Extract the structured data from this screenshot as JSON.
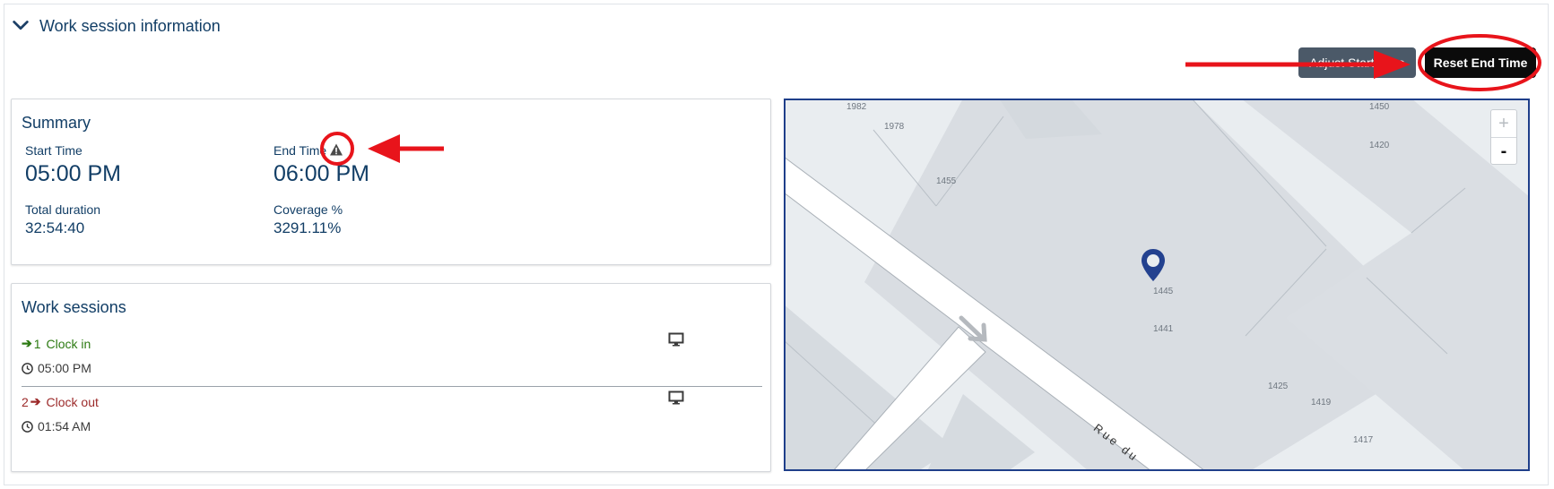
{
  "header": {
    "title": "Work session information",
    "icon": "chevron-down-icon"
  },
  "buttons": {
    "adjust_start": "Adjust Start Time",
    "reset_end": "Reset End Time"
  },
  "summary": {
    "title": "Summary",
    "start_label": "Start Time",
    "start_value": "05:00 PM",
    "end_label": "End Time",
    "end_value": "06:00 PM",
    "duration_label": "Total duration",
    "duration_value": "32:54:40",
    "coverage_label": "Coverage %",
    "coverage_value": "3291.11%",
    "warning_icon": "warning-icon"
  },
  "sessions": {
    "title": "Work sessions",
    "items": [
      {
        "prefix": "1",
        "label": "Clock in",
        "time": "05:00 PM"
      },
      {
        "prefix": "2",
        "label": "Clock out",
        "time": "01:54 AM"
      }
    ]
  },
  "map": {
    "zoom_in": "+",
    "zoom_out": "-",
    "labels": {
      "n1982": "1982",
      "n1978": "1978",
      "n1455": "1455",
      "n1450": "1450",
      "n1420": "1420",
      "n1445": "1445",
      "n1441": "1441",
      "n1425": "1425",
      "n1419": "1419",
      "n1417": "1417",
      "street": "Rue du"
    }
  },
  "colors": {
    "title_blue": "#123e66",
    "clock_in": "#2c7a12",
    "clock_out": "#9c2a2a",
    "annotation_red": "#e8141b",
    "map_border": "#1f3f8a",
    "pin": "#23418f"
  }
}
